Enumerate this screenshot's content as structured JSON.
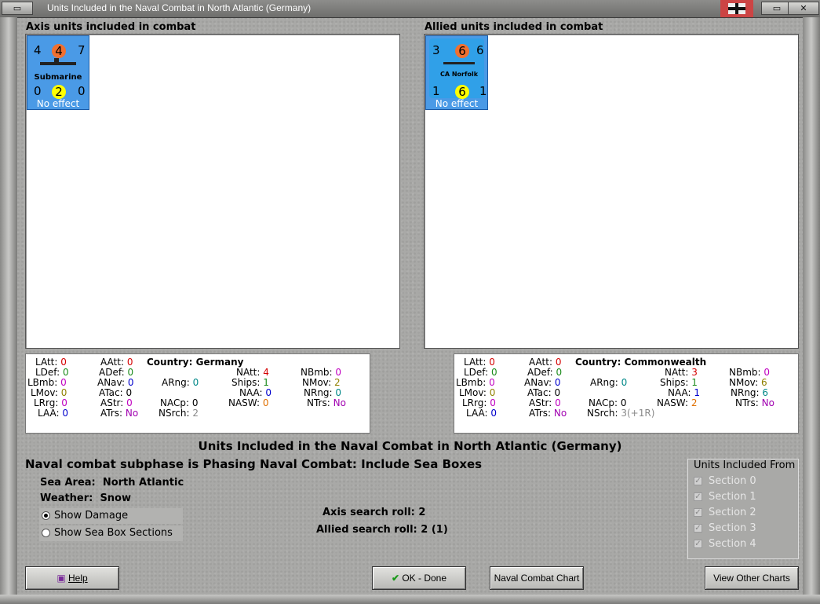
{
  "window": {
    "title": "Units Included in the Naval Combat in North Atlantic (Germany)"
  },
  "axis": {
    "header": "Axis units included in combat",
    "unit": {
      "top_left": "4",
      "top_mid": "4",
      "top_right": "7",
      "name": "Submarine",
      "bot_left": "0",
      "bot_mid": "2",
      "bot_right": "0",
      "status": "No effect",
      "bg": "#4a9ae6"
    },
    "stats": {
      "LAtt": "0",
      "LDef": "0",
      "LBmb": "0",
      "LMov": "0",
      "LRrg": "0",
      "LAA": "0",
      "AAtt": "0",
      "ADef": "0",
      "ANav": "0",
      "ATac": "0",
      "AStr": "0",
      "ATrs": "No",
      "country_label": "Country:",
      "country": "Germany",
      "ARng": "0",
      "NACp": "0",
      "NSrch": "2",
      "NAtt": "4",
      "Ships": "1",
      "NAA": "0",
      "NASW": "0",
      "NBmb": "0",
      "NMov": "2",
      "NRng": "0",
      "NTrs": "No"
    }
  },
  "allied": {
    "header": "Allied units included in combat",
    "unit": {
      "top_left": "3",
      "top_mid": "6",
      "top_right": "6",
      "name": "CA Norfolk",
      "bot_left": "1",
      "bot_mid": "6",
      "bot_right": "1",
      "status": "No effect",
      "bg": "#4a9ae6"
    },
    "stats": {
      "LAtt": "0",
      "LDef": "0",
      "LBmb": "0",
      "LMov": "0",
      "LRrg": "0",
      "LAA": "0",
      "AAtt": "0",
      "ADef": "0",
      "ANav": "0",
      "ATac": "0",
      "AStr": "0",
      "ATrs": "No",
      "country_label": "Country:",
      "country": "Commonwealth",
      "ARng": "0",
      "NACp": "0",
      "NSrch": "3(+1R)",
      "NAtt": "3",
      "Ships": "1",
      "NAA": "1",
      "NASW": "2",
      "NBmb": "0",
      "NMov": "6",
      "NRng": "6",
      "NTrs": "No"
    }
  },
  "stat_labels": {
    "LAtt": "LAtt:",
    "LDef": "LDef:",
    "LBmb": "LBmb:",
    "LMov": "LMov:",
    "LRrg": "LRrg:",
    "LAA": "LAA:",
    "AAtt": "AAtt:",
    "ADef": "ADef:",
    "ANav": "ANav:",
    "ATac": "ATac:",
    "AStr": "AStr:",
    "ATrs": "ATrs:",
    "ARng": "ARng:",
    "NACp": "NACp:",
    "NSrch": "NSrch:",
    "NAtt": "NAtt:",
    "Ships": "Ships:",
    "NAA": "NAA:",
    "NASW": "NASW:",
    "NBmb": "NBmb:",
    "NMov": "NMov:",
    "NRng": "NRng:",
    "NTrs": "NTrs:"
  },
  "main": {
    "heading": "Units Included in the Naval Combat in North Atlantic (Germany)",
    "subphase": "Naval combat subphase is Phasing Naval Combat: Include Sea Boxes",
    "sea_area_label": "Sea Area:",
    "sea_area": "North Atlantic",
    "weather_label": "Weather:",
    "weather": "Snow",
    "show_damage": "Show Damage",
    "show_sea_box": "Show Sea Box Sections",
    "axis_search_label": "Axis search roll:",
    "axis_search": "2",
    "allied_search_label": "Allied search roll:",
    "allied_search": "2 (1)"
  },
  "included_from": {
    "title": "Units Included From",
    "sections": [
      "Section 0",
      "Section 1",
      "Section 2",
      "Section 3",
      "Section 4"
    ]
  },
  "buttons": {
    "help": "Help",
    "ok": "OK - Done",
    "naval_chart": "Naval Combat Chart",
    "other_charts": "View Other Charts"
  }
}
